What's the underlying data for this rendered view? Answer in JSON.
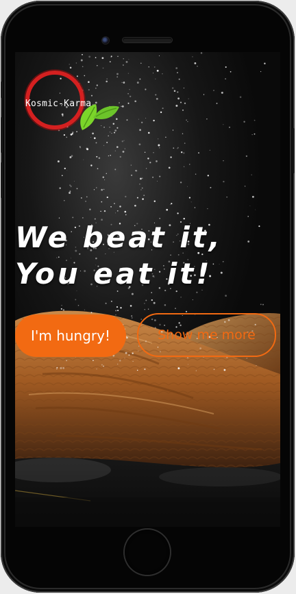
{
  "brand": {
    "logo_text": "Kosmic-Karma",
    "ring_color": "#d42020",
    "leaf_color": "#7bd52a"
  },
  "hero": {
    "line1": "We beat it,",
    "line2": "You eat it!"
  },
  "actions": {
    "primary_label": "I'm hungry!",
    "secondary_label": "Show me more",
    "accent_color": "#f26a12"
  },
  "device": {
    "icons": [
      "front-camera-icon",
      "speaker-grille-icon",
      "home-button-icon"
    ]
  }
}
